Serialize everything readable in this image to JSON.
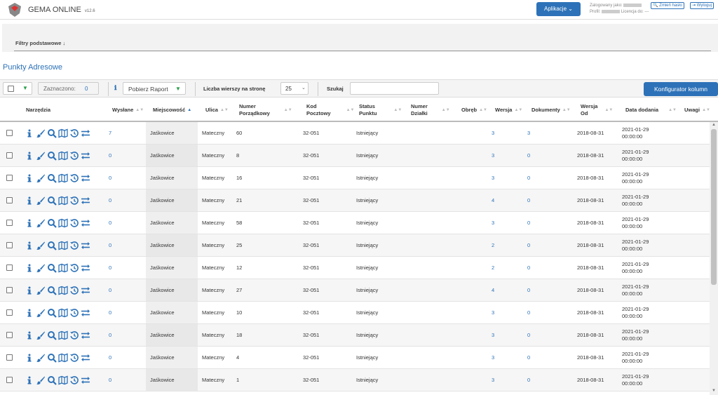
{
  "header": {
    "brand": "GEMA ONLINE",
    "version": "v12.6",
    "apps_button": "Aplikacje ⌄",
    "logged_as": "Zalogowany jako:",
    "profile": "Profil:",
    "license": "Licencja do: ---",
    "change_password": "Zmień hasło",
    "logout": "Wyloguj"
  },
  "filters": {
    "label": "Filtry podstawowe ↓"
  },
  "page_title": "Punkty Adresowe",
  "toolbar": {
    "marked_label": "Zaznaczono:",
    "marked_count": "0",
    "report_button": "Pobierz Raport",
    "rows_per_page_label": "Liczba wierszy na stronę",
    "rows_per_page_value": "25",
    "search_label": "Szukaj",
    "search_value": "",
    "column_config_button": "Konfigurator kolumn"
  },
  "columns": {
    "tools": "Narzędzia",
    "sent": "Wysłane",
    "town": "Miejscowość",
    "street": "Ulica",
    "number_1": "Numer",
    "number_2": "Porządkowy",
    "postal_1": "Kod",
    "postal_2": "Pocztowy",
    "status_1": "Status",
    "status_2": "Punktu",
    "parcel_1": "Numer",
    "parcel_2": "Działki",
    "precinct": "Obręb",
    "version": "Wersja",
    "documents": "Dokumenty",
    "version_from_1": "Wersja",
    "version_from_2": "Od",
    "date_added": "Data dodania",
    "notes": "Uwagi"
  },
  "icons": [
    "info-icon",
    "brush-icon",
    "search-icon",
    "map-icon",
    "history-icon",
    "exchange-icon"
  ],
  "colors": {
    "accent": "#2d72b8",
    "green": "#2aa04a"
  },
  "rows": [
    {
      "sent": "7",
      "town": "Jaśkowice",
      "street": "Mateczny",
      "number": "60",
      "postal": "32-051",
      "status": "Istniejący",
      "parcel": "",
      "precinct": "",
      "version": "3",
      "documents": "3",
      "version_from": "2018-08-31",
      "date": "2021-01-29",
      "time": "00:00:00",
      "notes": ""
    },
    {
      "sent": "0",
      "town": "Jaśkowice",
      "street": "Mateczny",
      "number": "8",
      "postal": "32-051",
      "status": "Istniejący",
      "parcel": "",
      "precinct": "",
      "version": "3",
      "documents": "0",
      "version_from": "2018-08-31",
      "date": "2021-01-29",
      "time": "00:00:00",
      "notes": ""
    },
    {
      "sent": "0",
      "town": "Jaśkowice",
      "street": "Mateczny",
      "number": "16",
      "postal": "32-051",
      "status": "Istniejący",
      "parcel": "",
      "precinct": "",
      "version": "3",
      "documents": "0",
      "version_from": "2018-08-31",
      "date": "2021-01-29",
      "time": "00:00:00",
      "notes": ""
    },
    {
      "sent": "0",
      "town": "Jaśkowice",
      "street": "Mateczny",
      "number": "21",
      "postal": "32-051",
      "status": "Istniejący",
      "parcel": "",
      "precinct": "",
      "version": "4",
      "documents": "0",
      "version_from": "2018-08-31",
      "date": "2021-01-29",
      "time": "00:00:00",
      "notes": ""
    },
    {
      "sent": "0",
      "town": "Jaśkowice",
      "street": "Mateczny",
      "number": "58",
      "postal": "32-051",
      "status": "Istniejący",
      "parcel": "",
      "precinct": "",
      "version": "3",
      "documents": "0",
      "version_from": "2018-08-31",
      "date": "2021-01-29",
      "time": "00:00:00",
      "notes": ""
    },
    {
      "sent": "0",
      "town": "Jaśkowice",
      "street": "Mateczny",
      "number": "25",
      "postal": "32-051",
      "status": "Istniejący",
      "parcel": "",
      "precinct": "",
      "version": "2",
      "documents": "0",
      "version_from": "2018-08-31",
      "date": "2021-01-29",
      "time": "00:00:00",
      "notes": ""
    },
    {
      "sent": "0",
      "town": "Jaśkowice",
      "street": "Mateczny",
      "number": "12",
      "postal": "32-051",
      "status": "Istniejący",
      "parcel": "",
      "precinct": "",
      "version": "2",
      "documents": "0",
      "version_from": "2018-08-31",
      "date": "2021-01-29",
      "time": "00:00:00",
      "notes": ""
    },
    {
      "sent": "0",
      "town": "Jaśkowice",
      "street": "Mateczny",
      "number": "27",
      "postal": "32-051",
      "status": "Istniejący",
      "parcel": "",
      "precinct": "",
      "version": "4",
      "documents": "0",
      "version_from": "2018-08-31",
      "date": "2021-01-29",
      "time": "00:00:00",
      "notes": ""
    },
    {
      "sent": "0",
      "town": "Jaśkowice",
      "street": "Mateczny",
      "number": "10",
      "postal": "32-051",
      "status": "Istniejący",
      "parcel": "",
      "precinct": "",
      "version": "3",
      "documents": "0",
      "version_from": "2018-08-31",
      "date": "2021-01-29",
      "time": "00:00:00",
      "notes": ""
    },
    {
      "sent": "0",
      "town": "Jaśkowice",
      "street": "Mateczny",
      "number": "18",
      "postal": "32-051",
      "status": "Istniejący",
      "parcel": "",
      "precinct": "",
      "version": "3",
      "documents": "0",
      "version_from": "2018-08-31",
      "date": "2021-01-29",
      "time": "00:00:00",
      "notes": ""
    },
    {
      "sent": "0",
      "town": "Jaśkowice",
      "street": "Mateczny",
      "number": "4",
      "postal": "32-051",
      "status": "Istniejący",
      "parcel": "",
      "precinct": "",
      "version": "3",
      "documents": "0",
      "version_from": "2018-08-31",
      "date": "2021-01-29",
      "time": "00:00:00",
      "notes": ""
    },
    {
      "sent": "0",
      "town": "Jaśkowice",
      "street": "Mateczny",
      "number": "1",
      "postal": "32-051",
      "status": "Istniejący",
      "parcel": "",
      "precinct": "",
      "version": "3",
      "documents": "0",
      "version_from": "2018-08-31",
      "date": "2021-01-29",
      "time": "00:00:00",
      "notes": ""
    }
  ]
}
